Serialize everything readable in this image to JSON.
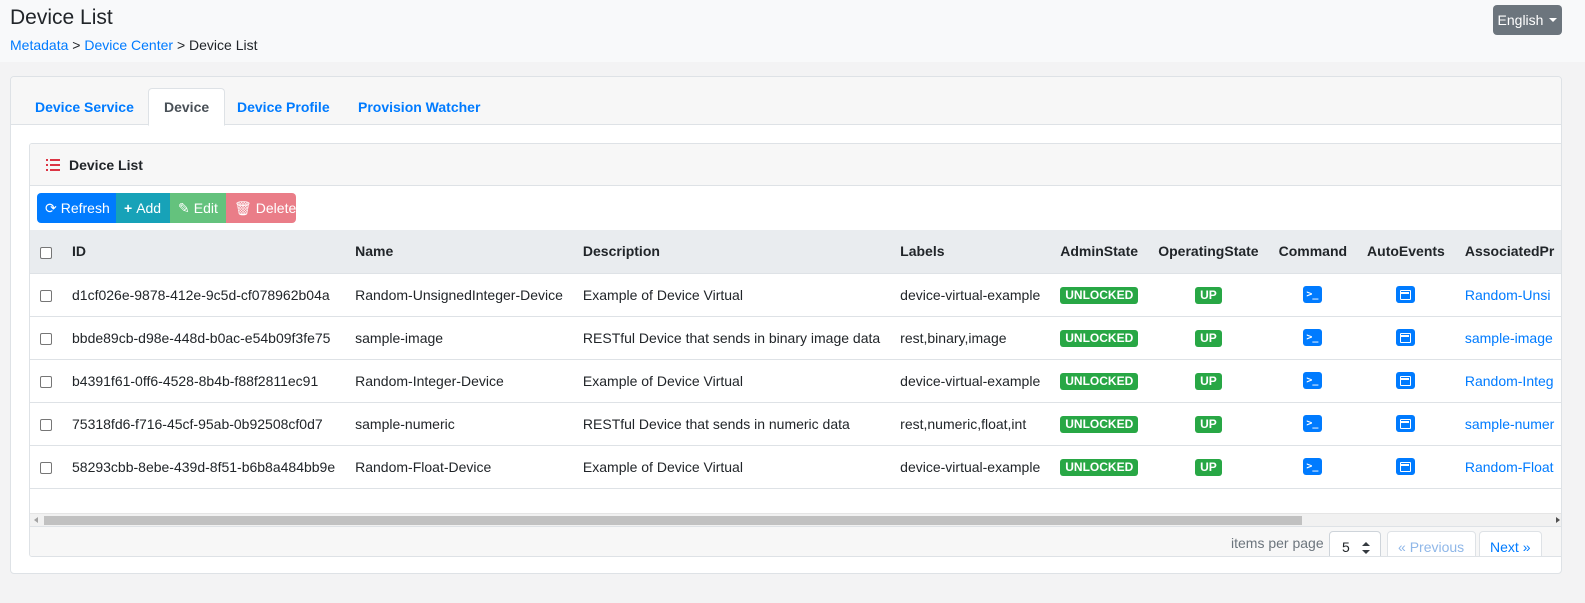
{
  "header": {
    "title": "Device List",
    "breadcrumb": [
      {
        "label": "Metadata"
      },
      {
        "label": "Device Center"
      },
      {
        "label": "Device List"
      }
    ],
    "separator": ">",
    "language_button": "English"
  },
  "tabs": [
    {
      "label": "Device Service",
      "active": false
    },
    {
      "label": "Device",
      "active": true
    },
    {
      "label": "Device Profile",
      "active": false
    },
    {
      "label": "Provision Watcher",
      "active": false
    }
  ],
  "card": {
    "title": "Device List",
    "title_icon": "list-icon",
    "toolbar": {
      "refresh": "Refresh",
      "add": "Add",
      "edit": "Edit",
      "delete": "Delete"
    }
  },
  "table": {
    "columns": [
      "ID",
      "Name",
      "Description",
      "Labels",
      "AdminState",
      "OperatingState",
      "Command",
      "AutoEvents",
      "AssociatedPr"
    ],
    "rows": [
      {
        "id": "d1cf026e-9878-412e-9c5d-cf078962b04a",
        "name": "Random-UnsignedInteger-Device",
        "description": "Example of Device Virtual",
        "labels": "device-virtual-example",
        "admin_state": "UNLOCKED",
        "operating_state": "UP",
        "associated": "Random-Unsi"
      },
      {
        "id": "bbde89cb-d98e-448d-b0ac-e54b09f3fe75",
        "name": "sample-image",
        "description": "RESTful Device that sends in binary image data",
        "labels": "rest,binary,image",
        "admin_state": "UNLOCKED",
        "operating_state": "UP",
        "associated": "sample-image"
      },
      {
        "id": "b4391f61-0ff6-4528-8b4b-f88f2811ec91",
        "name": "Random-Integer-Device",
        "description": "Example of Device Virtual",
        "labels": "device-virtual-example",
        "admin_state": "UNLOCKED",
        "operating_state": "UP",
        "associated": "Random-Integ"
      },
      {
        "id": "75318fd6-f716-45cf-95ab-0b92508cf0d7",
        "name": "sample-numeric",
        "description": "RESTful Device that sends in numeric data",
        "labels": "rest,numeric,float,int",
        "admin_state": "UNLOCKED",
        "operating_state": "UP",
        "associated": "sample-numer"
      },
      {
        "id": "58293cbb-8ebe-439d-8f51-b6b8a484bb9e",
        "name": "Random-Float-Device",
        "description": "Example of Device Virtual",
        "labels": "device-virtual-example",
        "admin_state": "UNLOCKED",
        "operating_state": "UP",
        "associated": "Random-Float"
      }
    ]
  },
  "pagination": {
    "items_per_page_label": "items per page",
    "items_per_page": "5",
    "previous": "Previous",
    "next": "Next"
  },
  "colors": {
    "primary": "#007bff",
    "info": "#17a2b8",
    "success": "#28a745",
    "danger": "#dc3545",
    "secondary": "#6c757d"
  }
}
